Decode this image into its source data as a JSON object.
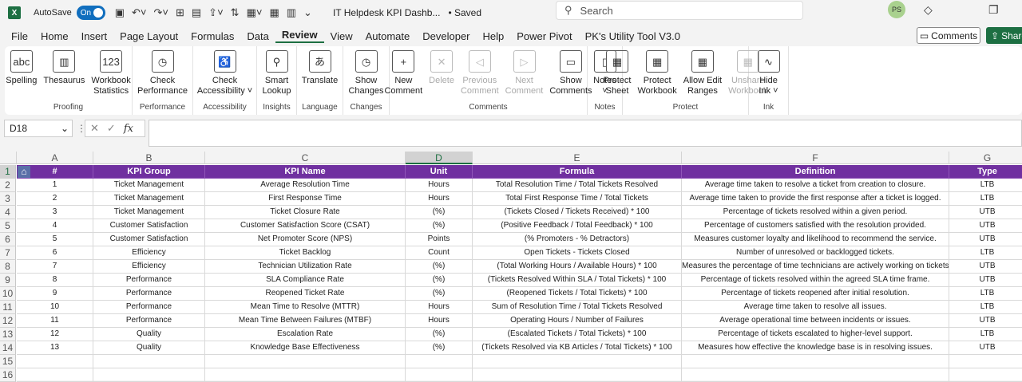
{
  "titlebar": {
    "app_icon": "X",
    "autosave_label": "AutoSave",
    "toggle_label": "On",
    "doc_title": "IT Helpdesk KPI Dashb...",
    "saved_status": "• Saved",
    "search_placeholder": "Search",
    "user_initials": "PS"
  },
  "menu": {
    "items": [
      "File",
      "Home",
      "Insert",
      "Page Layout",
      "Formulas",
      "Data",
      "Review",
      "View",
      "Automate",
      "Developer",
      "Help",
      "Power Pivot",
      "PK's Utility Tool V3.0"
    ],
    "active": "Review",
    "comments_label": "Comments",
    "share_label": "Share"
  },
  "ribbon": {
    "groups": [
      {
        "label": "Proofing",
        "buttons": [
          {
            "l1": "Spelling",
            "l2": "",
            "icon": "abc"
          },
          {
            "l1": "Thesaurus",
            "l2": "",
            "icon": "▥"
          },
          {
            "l1": "Workbook",
            "l2": "Statistics",
            "icon": "123"
          }
        ]
      },
      {
        "label": "Performance",
        "buttons": [
          {
            "l1": "Check",
            "l2": "Performance",
            "icon": "◷"
          }
        ]
      },
      {
        "label": "Accessibility",
        "buttons": [
          {
            "l1": "Check",
            "l2": "Accessibility ˅",
            "icon": "♿"
          }
        ]
      },
      {
        "label": "Insights",
        "buttons": [
          {
            "l1": "Smart",
            "l2": "Lookup",
            "icon": "⚲"
          }
        ]
      },
      {
        "label": "Language",
        "buttons": [
          {
            "l1": "Translate",
            "l2": "",
            "icon": "あ"
          }
        ]
      },
      {
        "label": "Changes",
        "buttons": [
          {
            "l1": "Show",
            "l2": "Changes",
            "icon": "◷"
          }
        ]
      },
      {
        "label": "Comments",
        "buttons": [
          {
            "l1": "New",
            "l2": "Comment",
            "icon": "+"
          },
          {
            "l1": "Delete",
            "l2": "",
            "icon": "✕",
            "disabled": true
          },
          {
            "l1": "Previous",
            "l2": "Comment",
            "icon": "◁",
            "disabled": true
          },
          {
            "l1": "Next",
            "l2": "Comment",
            "icon": "▷",
            "disabled": true
          },
          {
            "l1": "Show",
            "l2": "Comments",
            "icon": "▭"
          }
        ]
      },
      {
        "label": "Notes",
        "buttons": [
          {
            "l1": "Notes",
            "l2": "˅",
            "icon": "▯"
          }
        ]
      },
      {
        "label": "Protect",
        "buttons": [
          {
            "l1": "Protect",
            "l2": "Sheet",
            "icon": "▦"
          },
          {
            "l1": "Protect",
            "l2": "Workbook",
            "icon": "▦"
          },
          {
            "l1": "Allow Edit",
            "l2": "Ranges",
            "icon": "▦"
          },
          {
            "l1": "Unshare",
            "l2": "Workbook",
            "icon": "▦",
            "disabled": true
          }
        ]
      },
      {
        "label": "Ink",
        "buttons": [
          {
            "l1": "Hide",
            "l2": "Ink ˅",
            "icon": "∿"
          }
        ]
      }
    ]
  },
  "formula_bar": {
    "name_box": "D18",
    "fx_label": "fx",
    "formula": ""
  },
  "sheet": {
    "columns": [
      "A",
      "B",
      "C",
      "D",
      "E",
      "F",
      "G"
    ],
    "selected_column": "D",
    "row_numbers": [
      "1",
      "2",
      "3",
      "4",
      "5",
      "6",
      "7",
      "8",
      "9",
      "10",
      "11",
      "12",
      "13",
      "14",
      "15",
      "16"
    ],
    "selected_row": "1",
    "header": [
      "#",
      "KPI Group",
      "KPI Name",
      "Unit",
      "Formula",
      "Definition",
      "Type"
    ],
    "rows": [
      [
        "1",
        "Ticket Management",
        "Average Resolution Time",
        "Hours",
        "Total Resolution Time / Total Tickets Resolved",
        "Average time taken to resolve a ticket from creation to closure.",
        "LTB"
      ],
      [
        "2",
        "Ticket Management",
        "First Response Time",
        "Hours",
        "Total First Response Time / Total Tickets",
        "Average time taken to provide the first response after a ticket is logged.",
        "LTB"
      ],
      [
        "3",
        "Ticket Management",
        "Ticket Closure Rate",
        "(%)",
        "(Tickets Closed / Tickets Received) * 100",
        "Percentage of tickets resolved within a given period.",
        "UTB"
      ],
      [
        "4",
        "Customer Satisfaction",
        "Customer Satisfaction Score (CSAT)",
        "(%)",
        "(Positive Feedback / Total Feedback) * 100",
        "Percentage of customers satisfied with the resolution provided.",
        "UTB"
      ],
      [
        "5",
        "Customer Satisfaction",
        "Net Promoter Score (NPS)",
        "Points",
        "(% Promoters - % Detractors)",
        "Measures customer loyalty and likelihood to recommend the service.",
        "UTB"
      ],
      [
        "6",
        "Efficiency",
        "Ticket Backlog",
        "Count",
        "Open Tickets - Tickets Closed",
        "Number of unresolved or backlogged tickets.",
        "LTB"
      ],
      [
        "7",
        "Efficiency",
        "Technician Utilization Rate",
        "(%)",
        "(Total Working Hours / Available Hours) * 100",
        "Measures the percentage of time technicians are actively working on tickets.",
        "UTB"
      ],
      [
        "8",
        "Performance",
        "SLA Compliance Rate",
        "(%)",
        "(Tickets Resolved Within SLA / Total Tickets) * 100",
        "Percentage of tickets resolved within the agreed SLA time frame.",
        "UTB"
      ],
      [
        "9",
        "Performance",
        "Reopened Ticket Rate",
        "(%)",
        "(Reopened Tickets / Total Tickets) * 100",
        "Percentage of tickets reopened after initial resolution.",
        "LTB"
      ],
      [
        "10",
        "Performance",
        "Mean Time to Resolve (MTTR)",
        "Hours",
        "Sum of Resolution Time / Total Tickets Resolved",
        "Average time taken to resolve all issues.",
        "LTB"
      ],
      [
        "11",
        "Performance",
        "Mean Time Between Failures (MTBF)",
        "Hours",
        "Operating Hours / Number of Failures",
        "Average operational time between incidents or issues.",
        "UTB"
      ],
      [
        "12",
        "Quality",
        "Escalation Rate",
        "(%)",
        "(Escalated Tickets / Total Tickets) * 100",
        "Percentage of tickets escalated to higher-level support.",
        "LTB"
      ],
      [
        "13",
        "Quality",
        "Knowledge Base Effectiveness",
        "(%)",
        "(Tickets Resolved via KB Articles / Total Tickets) * 100",
        "Measures how effective the knowledge base is in resolving issues.",
        "UTB"
      ]
    ]
  },
  "colors": {
    "header_purple": "#7030a0",
    "excel_green": "#1d6f42"
  },
  "icons": {
    "home_sheet": "home-icon"
  }
}
